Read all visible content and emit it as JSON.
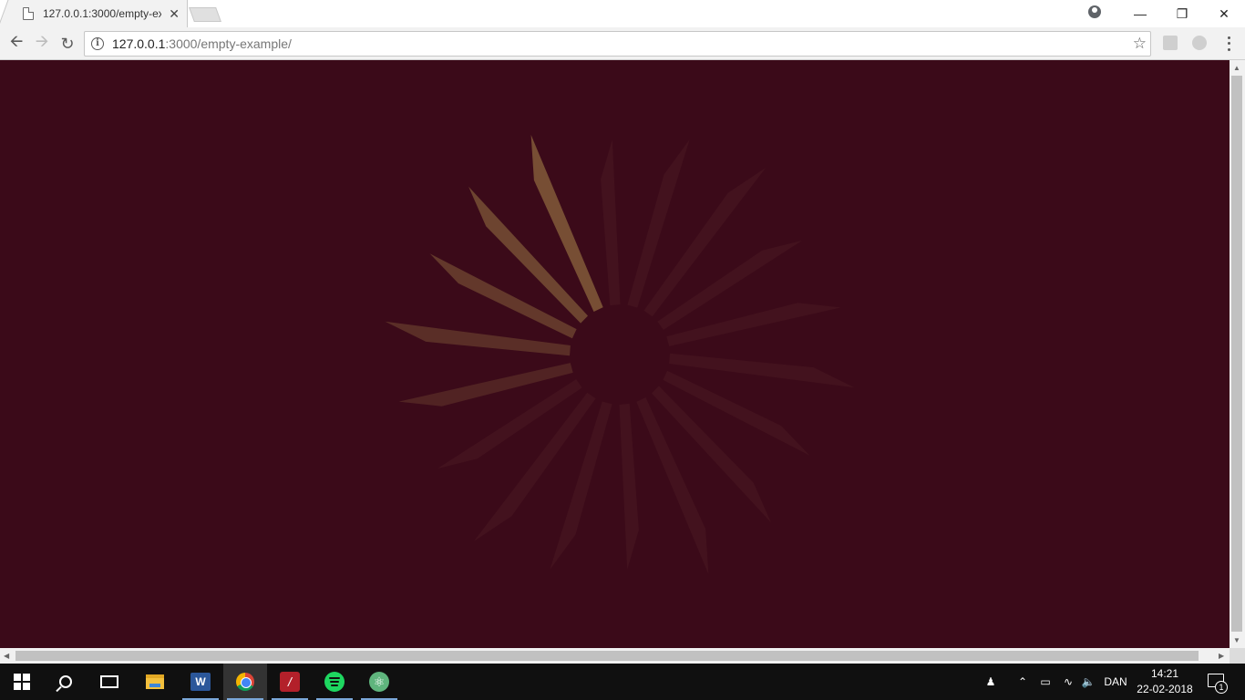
{
  "browser": {
    "tabs": [
      {
        "title": "127.0.0.1:3000/empty-ex",
        "active": true
      }
    ],
    "address": {
      "host": "127.0.0.1",
      "path": ":3000/empty-example/"
    },
    "icons": {
      "back": "back-arrow-icon",
      "forward": "forward-arrow-icon",
      "reload": "reload-icon",
      "info": "info-icon",
      "star": "star-icon",
      "menu": "kebab-menu-icon"
    }
  },
  "page": {
    "background_color": "#3b0a19",
    "spinner": {
      "type": "radial-spike-loader",
      "spike_count": 18,
      "highlight_color": "#7a5236",
      "base_color": "#4a1a23",
      "lit_spikes": 5
    }
  },
  "taskbar": {
    "apps": [
      {
        "name": "start",
        "icon": "windows-start-icon"
      },
      {
        "name": "search",
        "icon": "search-icon"
      },
      {
        "name": "task-view",
        "icon": "task-view-icon"
      },
      {
        "name": "file-explorer",
        "icon": "folder-icon"
      },
      {
        "name": "word",
        "icon": "word-icon",
        "label": "W"
      },
      {
        "name": "chrome",
        "icon": "chrome-icon"
      },
      {
        "name": "red-app",
        "icon": "red-app-icon"
      },
      {
        "name": "spotify",
        "icon": "spotify-icon"
      },
      {
        "name": "atom",
        "icon": "atom-icon"
      }
    ],
    "tray": {
      "language": "DAN",
      "time": "14:21",
      "date": "22-02-2018",
      "notifications": "1"
    }
  }
}
